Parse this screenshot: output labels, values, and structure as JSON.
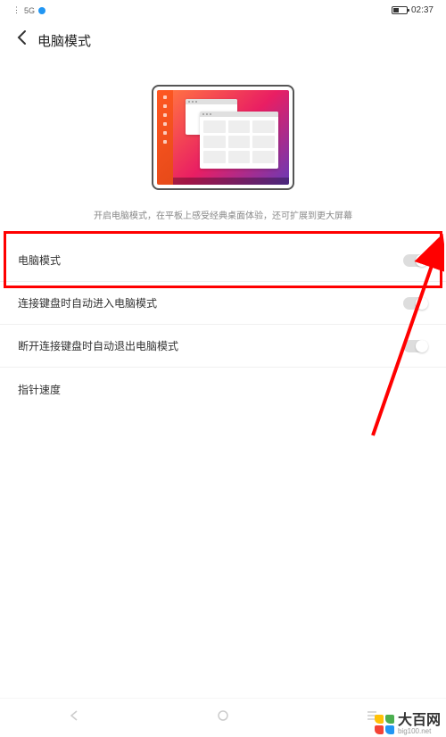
{
  "status": {
    "time": "02:37",
    "signal": "5G"
  },
  "header": {
    "title": "电脑模式"
  },
  "description": "开启电脑模式，在平板上感受经典桌面体验，还可扩展到更大屏幕",
  "settings": [
    {
      "label": "电脑模式",
      "has_toggle": true
    },
    {
      "label": "连接键盘时自动进入电脑模式",
      "has_toggle": true
    },
    {
      "label": "断开连接键盘时自动退出电脑模式",
      "has_toggle": true
    },
    {
      "label": "指针速度",
      "has_toggle": false
    }
  ],
  "watermark": {
    "text": "大百网",
    "url": "big100.net",
    "colors": [
      "#FFC107",
      "#4CAF50",
      "#F44336",
      "#2196F3"
    ]
  }
}
